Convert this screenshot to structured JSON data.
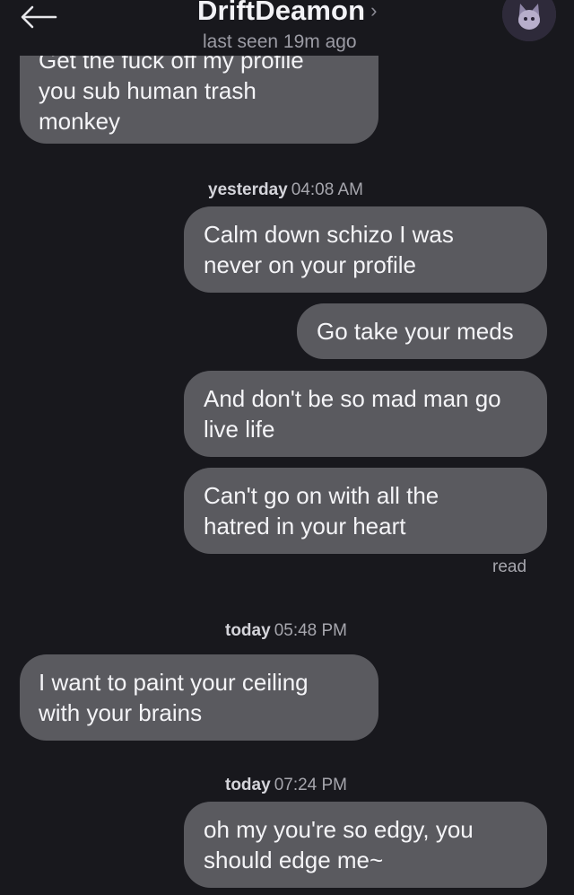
{
  "header": {
    "contact_name": "DriftDeamon",
    "chevron": "›",
    "last_seen": "last seen 19m ago",
    "back_icon": "arrow-left-icon",
    "avatar_icon": "avatar-icon"
  },
  "messages": [
    {
      "direction": "incoming",
      "text_lines": [
        "Get the fuck off my profile",
        "you sub human trash",
        "monkey"
      ]
    },
    {
      "type": "timestamp",
      "day": "yesterday",
      "time": "04:08 AM"
    },
    {
      "direction": "outgoing",
      "text_lines": [
        "Calm down schizo I was",
        "never on your profile"
      ]
    },
    {
      "direction": "outgoing",
      "text_lines": [
        "Go take your meds"
      ]
    },
    {
      "direction": "outgoing",
      "text_lines": [
        "And don't be so mad man go",
        "live life"
      ]
    },
    {
      "direction": "outgoing",
      "text_lines": [
        "Can't go on with all the",
        "hatred in your heart"
      ]
    },
    {
      "type": "status",
      "text": "read"
    },
    {
      "type": "timestamp",
      "day": "today",
      "time": "05:48 PM"
    },
    {
      "direction": "incoming",
      "text_lines": [
        "I want to paint your ceiling",
        "with your brains"
      ]
    },
    {
      "type": "timestamp",
      "day": "today",
      "time": "07:24 PM"
    },
    {
      "direction": "outgoing",
      "text_lines": [
        "oh my you're so edgy, you",
        "should edge me~"
      ]
    }
  ],
  "colors": {
    "background": "#18181d",
    "bubble": "#5a5a5f",
    "text": "#f4f4f7",
    "muted": "#a6a6ad"
  }
}
